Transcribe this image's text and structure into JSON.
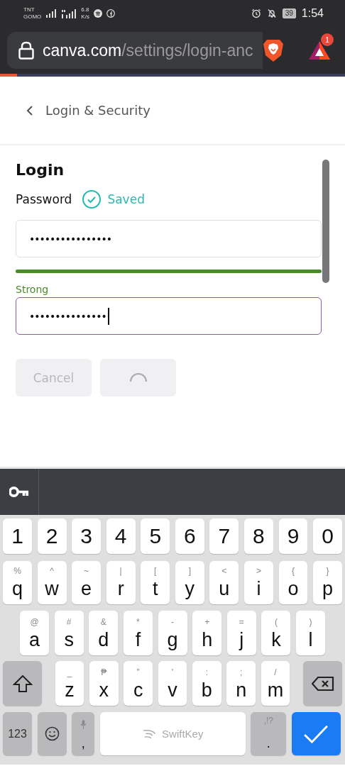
{
  "status_bar": {
    "carrier": [
      "TNT",
      "GOMO"
    ],
    "speed": [
      "6.8",
      "K/s"
    ],
    "battery": "39",
    "time": "1:54"
  },
  "browser": {
    "url_domain": "canva.com",
    "url_path": "/settings/login-anc",
    "rewards_badge": "1",
    "page_load": {
      "level": 0.05
    }
  },
  "header": {
    "back_label": "Login & Security"
  },
  "login": {
    "title": "Login",
    "password_label": "Password",
    "saved_label": "Saved",
    "fields": [
      {
        "value": "••••••••••••••••",
        "focused": false
      },
      {
        "value": "•••••••••••••••",
        "focused": true
      }
    ],
    "strength": {
      "level": 1,
      "label": "Strong"
    },
    "buttons": [
      {
        "kind": "text",
        "label": "Cancel",
        "disabled": true
      },
      {
        "kind": "spinner",
        "disabled": true
      }
    ]
  },
  "keyboard": {
    "rows": [
      [
        {
          "kind": "char",
          "label": "1"
        },
        {
          "kind": "char",
          "label": "2"
        },
        {
          "kind": "char",
          "label": "3"
        },
        {
          "kind": "char",
          "label": "4"
        },
        {
          "kind": "char",
          "label": "5"
        },
        {
          "kind": "char",
          "label": "6"
        },
        {
          "kind": "char",
          "label": "7"
        },
        {
          "kind": "char",
          "label": "8"
        },
        {
          "kind": "char",
          "label": "9"
        },
        {
          "kind": "char",
          "label": "0"
        }
      ],
      [
        {
          "kind": "char",
          "label": "q",
          "alt": "%"
        },
        {
          "kind": "char",
          "label": "w",
          "alt": "^"
        },
        {
          "kind": "char",
          "label": "e",
          "alt": "~"
        },
        {
          "kind": "char",
          "label": "r",
          "alt": "|"
        },
        {
          "kind": "char",
          "label": "t",
          "alt": "["
        },
        {
          "kind": "char",
          "label": "y",
          "alt": "]"
        },
        {
          "kind": "char",
          "label": "u",
          "alt": "<"
        },
        {
          "kind": "char",
          "label": "i",
          "alt": ">"
        },
        {
          "kind": "char",
          "label": "o",
          "alt": "{"
        },
        {
          "kind": "char",
          "label": "p",
          "alt": "}"
        }
      ],
      [
        {
          "kind": "char",
          "label": "a",
          "alt": "@"
        },
        {
          "kind": "char",
          "label": "s",
          "alt": "#"
        },
        {
          "kind": "char",
          "label": "d",
          "alt": "&"
        },
        {
          "kind": "char",
          "label": "f",
          "alt": "*"
        },
        {
          "kind": "char",
          "label": "g",
          "alt": "-"
        },
        {
          "kind": "char",
          "label": "h",
          "alt": "+"
        },
        {
          "kind": "char",
          "label": "j",
          "alt": "="
        },
        {
          "kind": "char",
          "label": "k",
          "alt": "("
        },
        {
          "kind": "char",
          "label": "l",
          "alt": ")"
        }
      ],
      [
        {
          "kind": "shift"
        },
        {
          "kind": "char",
          "label": "z",
          "alt": "_"
        },
        {
          "kind": "char",
          "label": "x",
          "alt": "₱"
        },
        {
          "kind": "char",
          "label": "c",
          "alt": "\""
        },
        {
          "kind": "char",
          "label": "v",
          "alt": "'"
        },
        {
          "kind": "char",
          "label": "b",
          "alt": ":"
        },
        {
          "kind": "char",
          "label": "n",
          "alt": ";"
        },
        {
          "kind": "char",
          "label": "m",
          "alt": "/"
        },
        {
          "kind": "backspace"
        }
      ],
      [
        {
          "kind": "mode",
          "label": "123"
        },
        {
          "kind": "emoji"
        },
        {
          "kind": "comma",
          "label": ","
        },
        {
          "kind": "space",
          "label": "SwiftKey"
        },
        {
          "kind": "period",
          "label": ".",
          "alt": ",!?"
        },
        {
          "kind": "enter"
        }
      ]
    ]
  }
}
